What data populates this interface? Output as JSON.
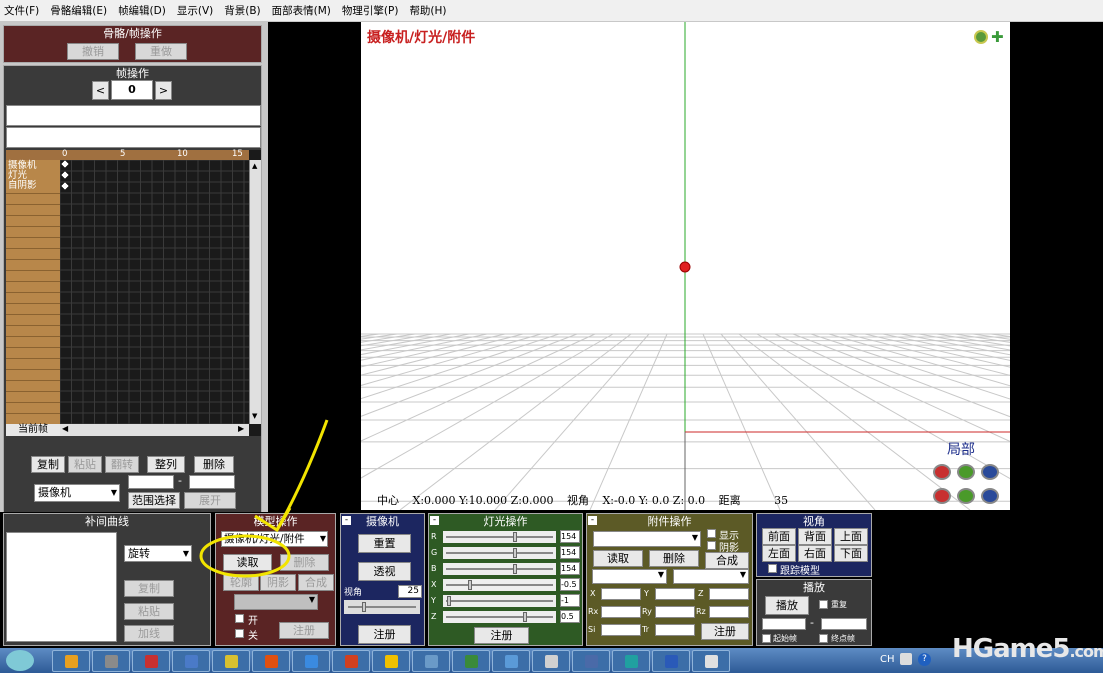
{
  "menu": [
    "文件(F)",
    "骨骼编辑(E)",
    "帧编辑(D)",
    "显示(V)",
    "背景(B)",
    "面部表情(M)",
    "物理引擎(P)",
    "帮助(H)"
  ],
  "bone_frame_ops": {
    "title": "骨骼/帧操作",
    "undo": "撤销",
    "redo": "重做"
  },
  "frame_ops": {
    "title": "帧操作",
    "prev": "<",
    "frame_value": "0",
    "next": ">"
  },
  "timeline": {
    "ticks": [
      "0",
      "5",
      "10",
      "15"
    ],
    "rows": [
      "摄像机",
      "灯光",
      "自阴影"
    ],
    "current_frame_label": "当前帧"
  },
  "frame_buttons": {
    "copy": "复制",
    "paste": "粘贴",
    "flip": "翻转",
    "arrange": "整列",
    "delete": "删除",
    "target": "摄像机",
    "range_select": "范围选择",
    "expand": "展开",
    "dash": "-"
  },
  "viewport": {
    "mode_title": "摄像机/灯光/附件",
    "local": "局部",
    "status": {
      "center_label": "中心",
      "center_value": "X:0.000 Y:10.000 Z:0.000",
      "angle_label": "视角",
      "angle_value": "X:-0.0 Y: 0.0 Z: 0.0",
      "dist_label": "距离",
      "dist_value": "35"
    },
    "colors": {
      "axis_red": "#cc2a2a",
      "axis_green": "#2aa82a",
      "title": "#c82020",
      "local": "#1e2f8c"
    }
  },
  "interp": {
    "title": "补间曲线",
    "type": "旋转",
    "copy": "复制",
    "paste": "粘贴",
    "linear": "加线"
  },
  "model_ops": {
    "title": "模型操作",
    "select": "摄像机/灯光/附件",
    "read": "读取",
    "delete": "删除",
    "outline": "轮廓",
    "shadow": "阴影",
    "compose": "合成",
    "on": "开",
    "off": "关",
    "register": "注册"
  },
  "camera": {
    "title": "摄像机",
    "reset": "重置",
    "perspective": "透视",
    "angle_label": "视角",
    "angle_value": "25",
    "register": "注册"
  },
  "light": {
    "title": "灯光操作",
    "labels": [
      "R",
      "G",
      "B",
      "X",
      "Y",
      "Z"
    ],
    "r": "154",
    "g": "154",
    "b": "154",
    "x": "-0.5",
    "y": "-1",
    "z": "0.5",
    "register": "注册"
  },
  "accessory": {
    "title": "附件操作",
    "show": "显示",
    "shadow": "阴影",
    "read": "读取",
    "delete": "删除",
    "compose": "合成",
    "fields": [
      "X",
      "Y",
      "Z",
      "Rx",
      "Ry",
      "Rz",
      "Si",
      "Tr"
    ],
    "register": "注册"
  },
  "view": {
    "title": "视角",
    "front": "前面",
    "back": "背面",
    "top": "上面",
    "left": "左面",
    "right": "右面",
    "bottom": "下面",
    "track": "跟踪模型"
  },
  "play": {
    "title": "播放",
    "play": "播放",
    "repeat": "重复",
    "start": "起始帧",
    "end": "终点帧",
    "dash": "-"
  },
  "taskbar": {
    "lang": "CH",
    "watermark": "HGame5",
    "watermark_suffix": ".com"
  }
}
